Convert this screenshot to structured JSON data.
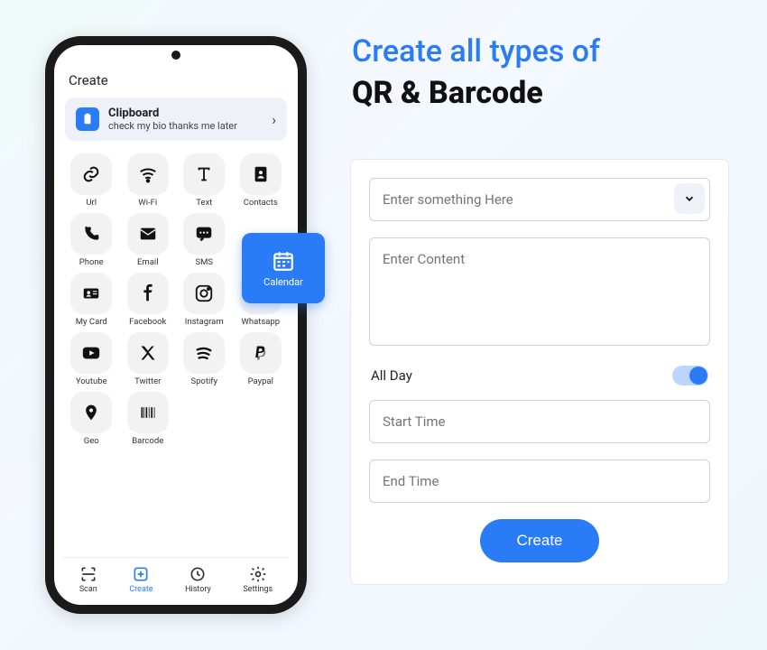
{
  "headline": {
    "line1": "Create all types of",
    "line2": "QR & Barcode"
  },
  "phone": {
    "title": "Create",
    "clipboard": {
      "title": "Clipboard",
      "subtitle": "check my bio thanks me later"
    },
    "tiles": [
      {
        "label": "Url"
      },
      {
        "label": "Wi-Fi"
      },
      {
        "label": "Text"
      },
      {
        "label": "Contacts"
      },
      {
        "label": "Phone"
      },
      {
        "label": "Email"
      },
      {
        "label": "SMS"
      },
      {
        "label": "Calendar"
      },
      {
        "label": "My Card"
      },
      {
        "label": "Facebook"
      },
      {
        "label": "Instagram"
      },
      {
        "label": "Whatsapp"
      },
      {
        "label": "Youtube"
      },
      {
        "label": "Twitter"
      },
      {
        "label": "Spotify"
      },
      {
        "label": "Paypal"
      },
      {
        "label": "Geo"
      },
      {
        "label": "Barcode"
      }
    ],
    "nav": [
      {
        "label": "Scan"
      },
      {
        "label": "Create"
      },
      {
        "label": "History"
      },
      {
        "label": "Settings"
      }
    ]
  },
  "callout": {
    "label": "Calendar"
  },
  "form": {
    "title_placeholder": "Enter something Here",
    "content_placeholder": "Enter Content",
    "allday_label": "All Day",
    "start_placeholder": "Start Time",
    "end_placeholder": "End Time",
    "submit_label": "Create"
  }
}
